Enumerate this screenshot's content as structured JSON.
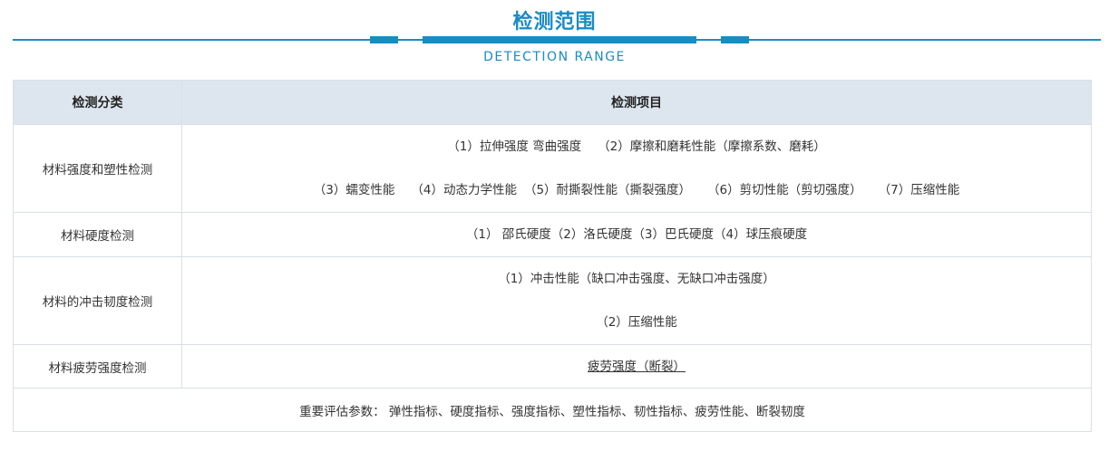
{
  "header": {
    "title": "检测范围",
    "subtitle": "DETECTION RANGE"
  },
  "table": {
    "col_category": "检测分类",
    "col_items": "检测项目",
    "rows": [
      {
        "category": "材料强度和塑性检测",
        "lines": [
          [
            "（1）拉伸强度 弯曲强度",
            "（2）摩擦和磨耗性能（摩擦系数、磨耗）"
          ],
          [
            "（3）蠕变性能",
            "（4）动态力学性能",
            "（5）耐撕裂性能（撕裂强度）",
            "（6）剪切性能（剪切强度）",
            "（7）压缩性能"
          ]
        ]
      },
      {
        "category": "材料硬度检测",
        "lines": [
          [
            "（1） 邵氏硬度（2）洛氏硬度（3）巴氏硬度（4）球压痕硬度"
          ]
        ]
      },
      {
        "category": "材料的冲击韧度检测",
        "lines": [
          [
            "（1）冲击性能（缺口冲击强度、无缺口冲击强度）"
          ],
          [
            "（2）压缩性能"
          ]
        ]
      },
      {
        "category": "材料疲劳强度检测",
        "lines": [
          [
            "疲劳强度（断裂）"
          ]
        ]
      }
    ],
    "footer": "重要评估参数： 弹性指标、硬度指标、强度指标、塑性指标、韧性指标、疲劳性能、断裂韧度"
  },
  "colors": {
    "accent": "#1a8cc4",
    "header_bg": "#dde6ef",
    "border": "#d9dfe6"
  }
}
